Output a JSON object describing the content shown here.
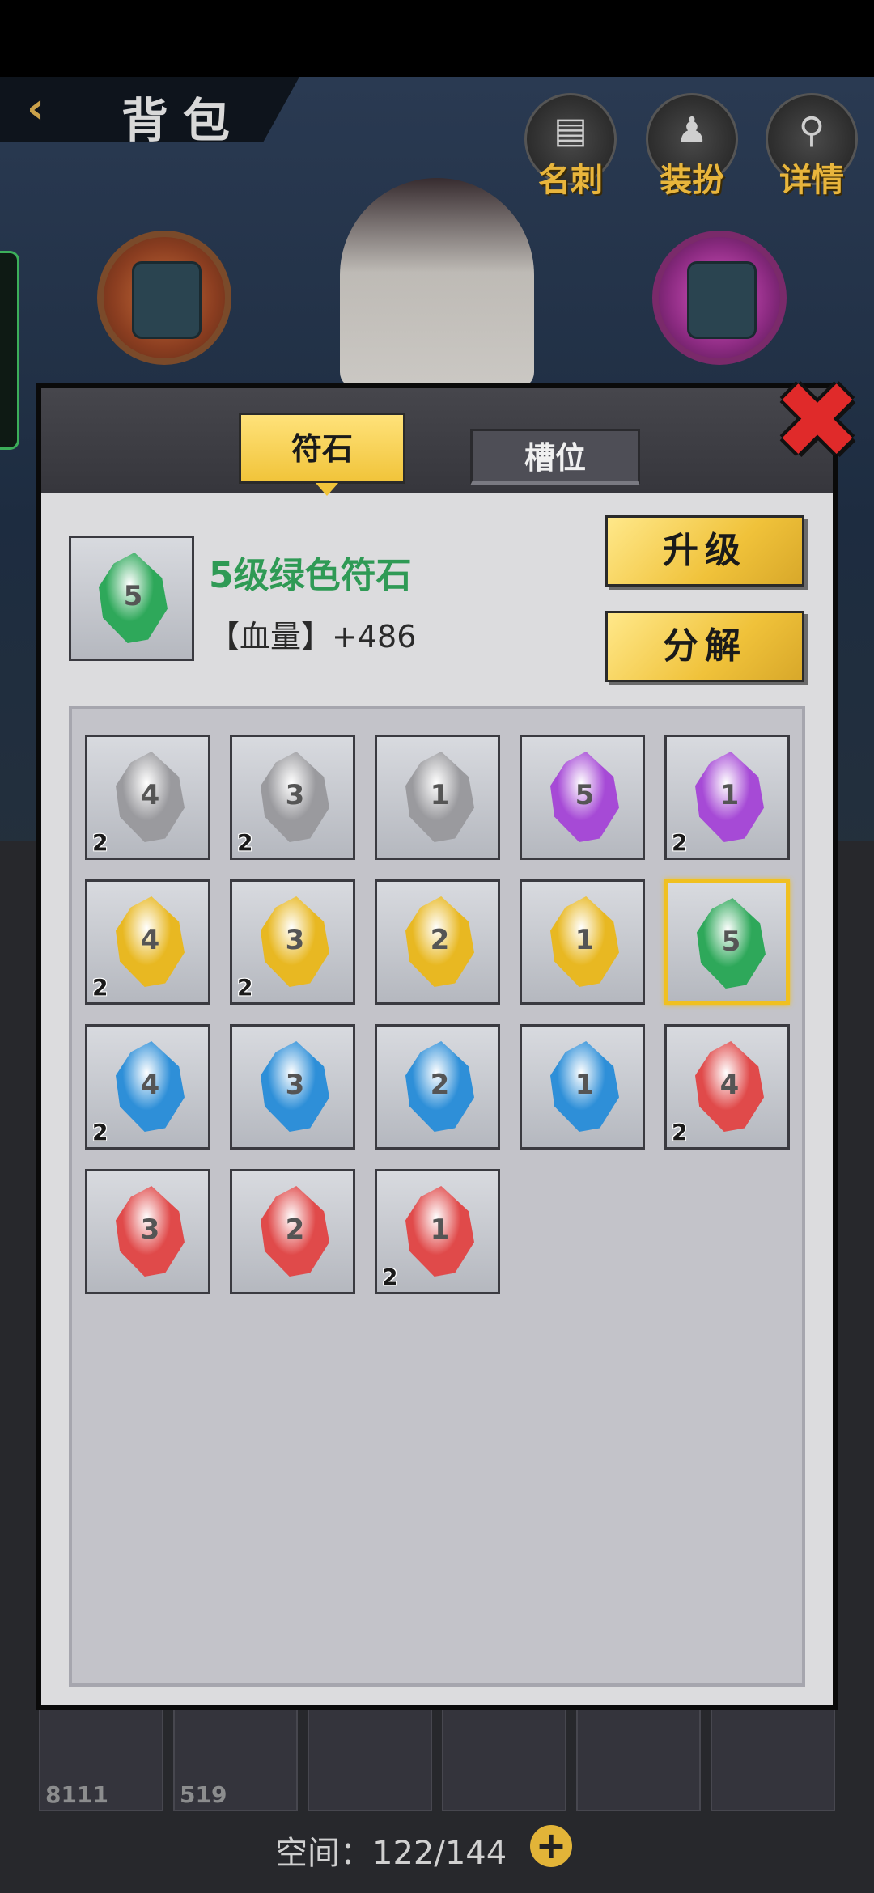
{
  "header": {
    "back_icon": "back-chevron-icon",
    "title": "背包",
    "icons": [
      {
        "name": "名刺",
        "icon": "card-icon",
        "glyph": "▤"
      },
      {
        "name": "装扮",
        "icon": "costume-icon",
        "glyph": "♟"
      },
      {
        "name": "详情",
        "icon": "magnifier-icon",
        "glyph": "⚲"
      }
    ]
  },
  "bottom_bar": {
    "items": [
      {
        "count": "8111"
      },
      {
        "count": "519"
      },
      {
        "count": ""
      },
      {
        "count": ""
      },
      {
        "count": ""
      },
      {
        "count": ""
      }
    ],
    "capacity_text": "空间：122/144",
    "add_label": "+"
  },
  "dialog": {
    "tabs": [
      {
        "label": "符石",
        "active": true
      },
      {
        "label": "槽位",
        "active": false
      }
    ],
    "close_glyph": "✖",
    "selected": {
      "level": "5",
      "name": "5级绿色符石",
      "stat": "【血量】+486",
      "color": "#2ea85a"
    },
    "buttons": {
      "upgrade": "升级",
      "decompose": "分解"
    },
    "runes": [
      {
        "level": "4",
        "color": "#9a9a9e",
        "count": "2"
      },
      {
        "level": "3",
        "color": "#9a9a9e",
        "count": "2"
      },
      {
        "level": "1",
        "color": "#9a9a9e",
        "count": ""
      },
      {
        "level": "5",
        "color": "#a64ad6",
        "count": ""
      },
      {
        "level": "1",
        "color": "#a64ad6",
        "count": "2"
      },
      {
        "level": "4",
        "color": "#e8b822",
        "count": "2"
      },
      {
        "level": "3",
        "color": "#e8b822",
        "count": "2"
      },
      {
        "level": "2",
        "color": "#e8b822",
        "count": ""
      },
      {
        "level": "1",
        "color": "#e8b822",
        "count": ""
      },
      {
        "level": "5",
        "color": "#2ea85a",
        "count": "",
        "selected": true
      },
      {
        "level": "4",
        "color": "#2e8fd8",
        "count": "2"
      },
      {
        "level": "3",
        "color": "#2e8fd8",
        "count": ""
      },
      {
        "level": "2",
        "color": "#2e8fd8",
        "count": ""
      },
      {
        "level": "1",
        "color": "#2e8fd8",
        "count": ""
      },
      {
        "level": "4",
        "color": "#e04a4a",
        "count": "2"
      },
      {
        "level": "3",
        "color": "#e04a4a",
        "count": ""
      },
      {
        "level": "2",
        "color": "#e04a4a",
        "count": ""
      },
      {
        "level": "1",
        "color": "#e04a4a",
        "count": "2"
      }
    ]
  }
}
